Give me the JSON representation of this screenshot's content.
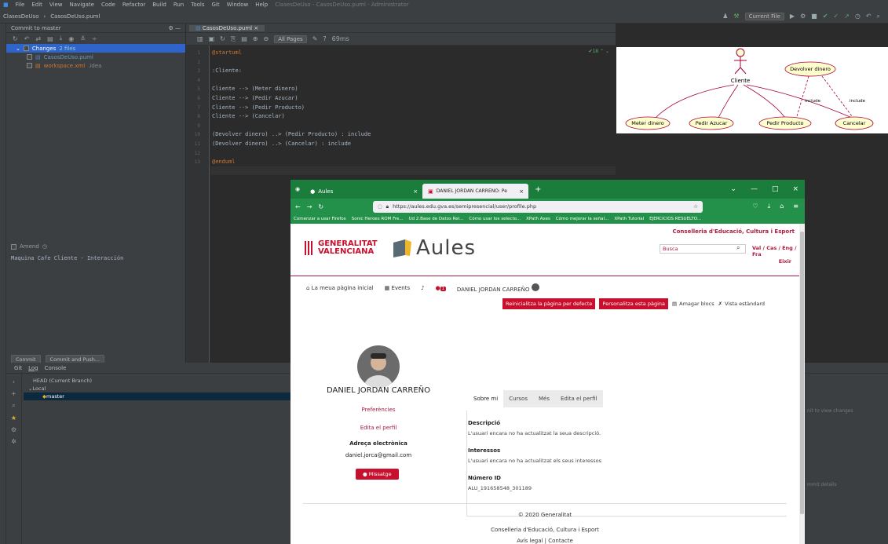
{
  "ide": {
    "menu": [
      "File",
      "Edit",
      "View",
      "Navigate",
      "Code",
      "Refactor",
      "Build",
      "Run",
      "Tools",
      "Git",
      "Window",
      "Help"
    ],
    "title_faded": "ClasesDeUso - CasosDeUso.puml - Administrator",
    "breadcrumb_project": "ClasesDeUso",
    "breadcrumb_file": "CasosDeUso.puml",
    "current_file": "Current File",
    "commit_tab": "Commit to master",
    "changes_label": "Changes",
    "changes_count": "2 files",
    "file1": "CasosDeUso.puml",
    "file2": "workspace.xml",
    "file2_dir": ".idea",
    "amend": "Amend",
    "commit_message": "Maquina Cafe Cliente - Interacción",
    "commit_button": "Commit",
    "commit_push_button": "Commit and Push...",
    "editor_tab": "CasosDeUso.puml",
    "all_pages": "All Pages",
    "render_time": "69ms",
    "warnings_count": "18",
    "line_numbers": [
      "1",
      "2",
      "3",
      "4",
      "5",
      "6",
      "7",
      "8",
      "9",
      "10",
      "11",
      "12",
      "13"
    ],
    "code_lines": [
      "@startuml",
      "",
      ":Cliente:",
      "",
      "Cliente --> (Meter dinero)",
      "Cliente --> (Pedir Azucar)",
      "Cliente --> (Pedir Producto)",
      "Cliente --> (Cancelar)",
      "",
      "(Devolver dinero) ..> (Pedir Producto) : include",
      "(Devolver dinero) ..> (Cancelar) : include",
      "",
      "@enduml"
    ],
    "git_tabs": [
      "Git",
      "Log",
      "Console"
    ],
    "git_head": "HEAD (Current Branch)",
    "git_local": "Local",
    "git_master": "master",
    "git_right1": "nit to view changes",
    "git_right2": "mmit details"
  },
  "diagram": {
    "actor": "Cliente",
    "use_cases": [
      "Meter dinero",
      "Pedir Azucar",
      "Pedir Producto",
      "Cancelar",
      "Devolver dinero"
    ],
    "include_label": "include"
  },
  "browser": {
    "tab1": "Aules",
    "tab2": "DANIEL JORDAN CARREÑO: Pe",
    "url": "https://aules.edu.gva.es/semipresencial/user/profile.php",
    "bookmarks": [
      "Comenzar a usar Firefox",
      "Sonic Heroes ROM Fre...",
      "Ud 2.Base de Datos Rel...",
      "Cómo usar los selecto...",
      "XPath Axes",
      "Cómo mejorar la señal...",
      "XPath Tutorial",
      "EJERCICIOS RESUELTO..."
    ],
    "conselleria": "Conselleria d'Educació, Cultura i Esport",
    "gv_line1": "GENERALITAT",
    "gv_line2": "VALENCIANA",
    "aules": "Aules",
    "search_placeholder": "Busca",
    "langs": "Val / Cas / Eng / Fra",
    "eixir": "Eixir",
    "nav_home": "La meua pàgina inicial",
    "nav_events": "Events",
    "msg_badge": "1",
    "nav_user": "DANIEL JORDAN CARREÑO",
    "btn_reset": "Reinicialitza la pàgina per defecte",
    "btn_customize": "Personalitza esta pàgina",
    "hide_blocks": "Amagar blocs",
    "standard_view": "Vista estàndard",
    "full_name": "DANIEL JORDAN CARREÑO",
    "preferences": "Preferències",
    "edit_profile": "Edita el perfil",
    "email_label": "Adreça electrònica",
    "email": "daniel.jorca@gmail.com",
    "message_btn": "Missatge",
    "tabs": [
      "Sobre mi",
      "Cursos",
      "Més",
      "Edita el perfil"
    ],
    "descripcio_h": "Descripció",
    "descripcio_t": "L'usuari encara no ha actualitzat la seua descripció.",
    "interessos_h": "Interessos",
    "interessos_t": "L'usuari encara no ha actualitzat els seus interessos",
    "numero_h": "Número ID",
    "numero_t": "ALU_191658548_301189",
    "footer1": "© 2020 Generalitat",
    "footer2": "Conselleria d'Educació, Cultura i Esport",
    "footer3": "Avís legal | Contacte"
  },
  "colors": {
    "accent_red": "#c8102e",
    "browser_green": "#1b7d3c"
  }
}
